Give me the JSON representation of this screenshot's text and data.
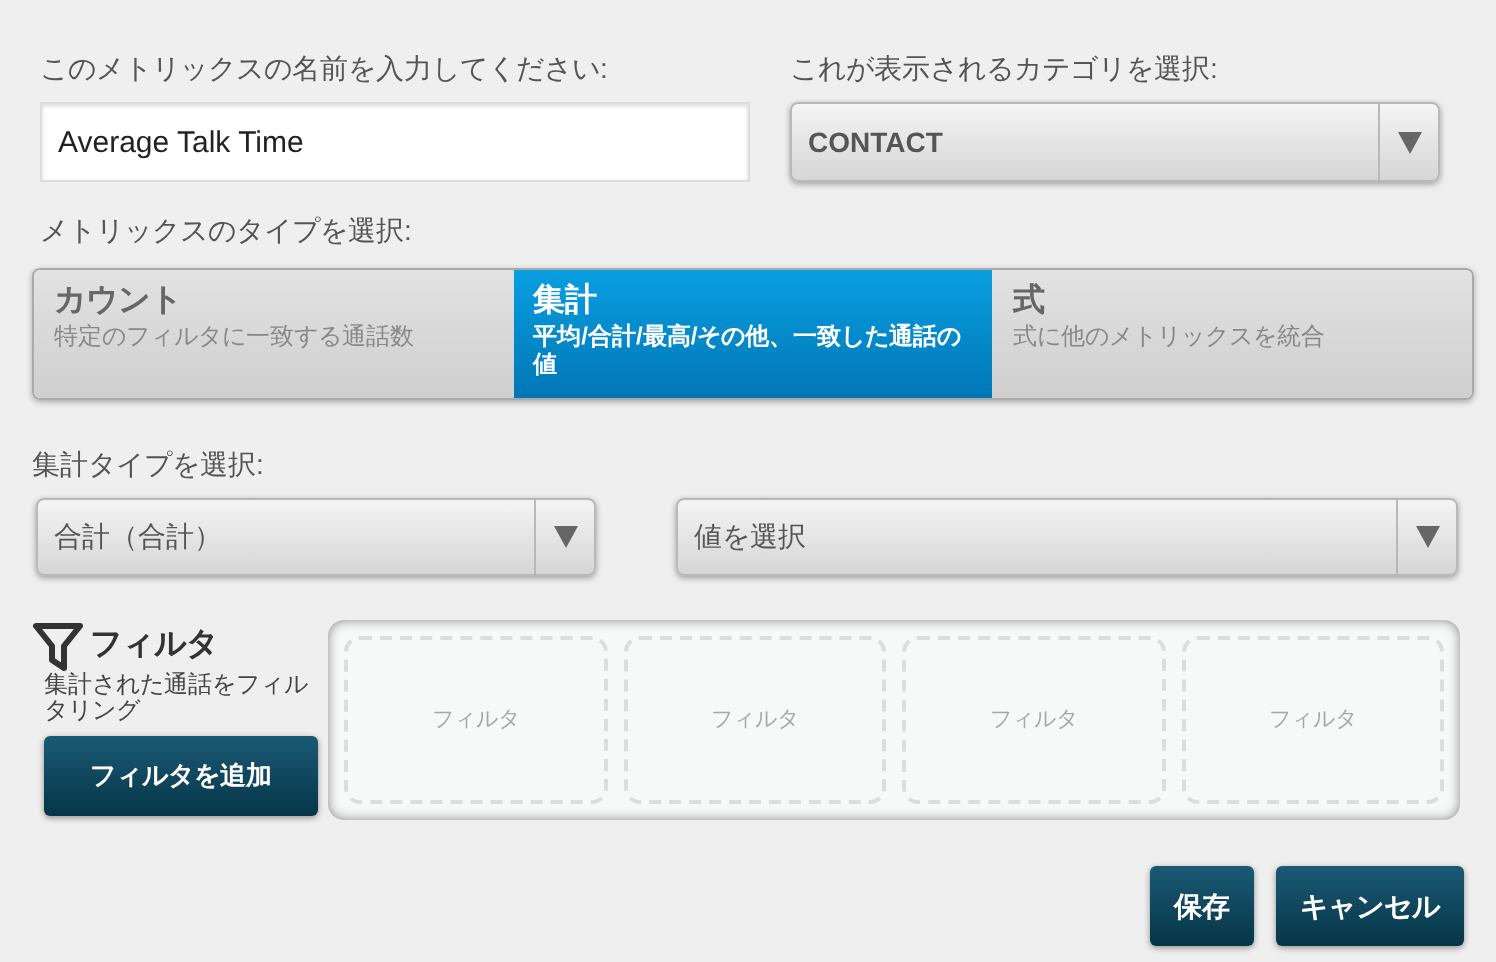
{
  "name_field": {
    "label": "このメトリックスの名前を入力してください:",
    "value": "Average Talk Time"
  },
  "category": {
    "label": "これが表示されるカテゴリを選択:",
    "value": "CONTACT"
  },
  "metric_type": {
    "label": "メトリックスのタイプを選択:",
    "options": [
      {
        "title": "カウント",
        "description": "特定のフィルタに一致する通話数",
        "selected": false
      },
      {
        "title": "集計",
        "description": "平均/合計/最高/その他、一致した通話の値",
        "selected": true
      },
      {
        "title": "式",
        "description": "式に他のメトリックスを統合",
        "selected": false
      }
    ]
  },
  "aggregate": {
    "label": "集計タイプを選択:",
    "type_value": "合計（合計）",
    "value_placeholder": "値を選択"
  },
  "filters": {
    "title": "フィルタ",
    "description": "集計された通話をフィルタリング",
    "add_button": "フィルタを追加",
    "slots": [
      "フィルタ",
      "フィルタ",
      "フィルタ",
      "フィルタ"
    ]
  },
  "buttons": [
    "保存",
    "キャンセル"
  ]
}
